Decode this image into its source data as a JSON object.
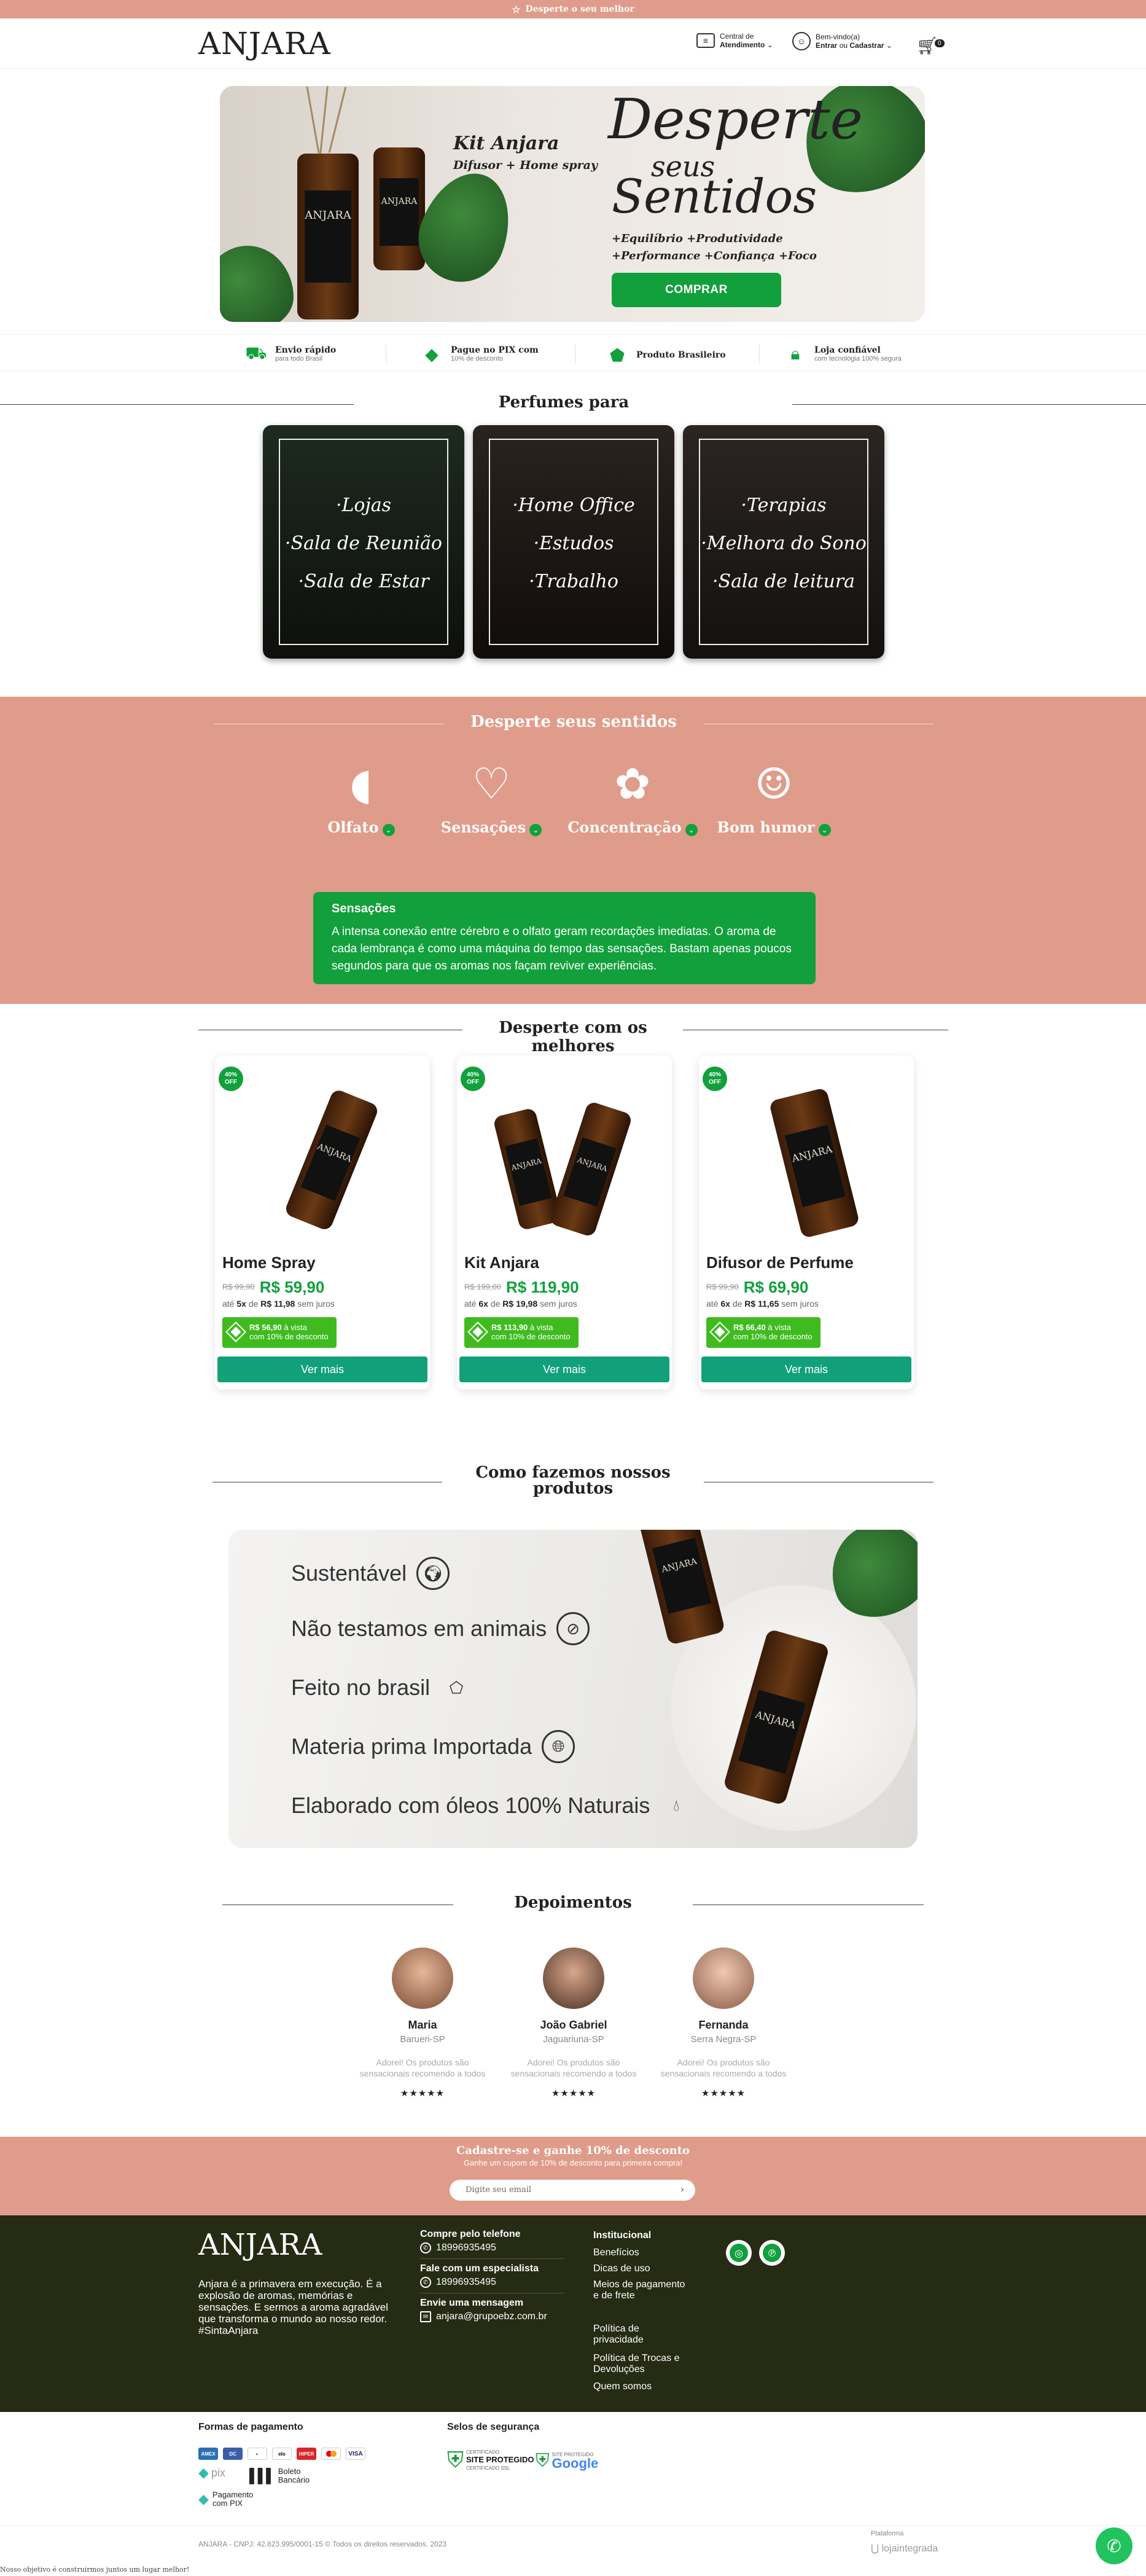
{
  "topbar": {
    "text": "Desperte o seu melhor"
  },
  "header": {
    "logo": "ANJARA",
    "central_line1": "Central de",
    "central_line2": "Atendimento",
    "welcome": "Bem-vindo(a)",
    "login": "Entrar",
    "or": "ou",
    "register": "Cadastrar",
    "cart_count": "0"
  },
  "hero": {
    "kit_title": "Kit Anjara",
    "kit_sub": "Difusor + Home spray",
    "script_1": "Desperte",
    "script_2": "seus",
    "script_3": "Sentidos",
    "benefits_1": "+Equilíbrio  +Produtividade",
    "benefits_2": "+Performance  +Confiança  +Foco",
    "bottle_label": "ANJARA",
    "cta": "COMPRAR"
  },
  "features": [
    {
      "title": "Envio rápido",
      "sub": "para todo Brasil",
      "icon": "truck-icon"
    },
    {
      "title": "Pague no PIX com",
      "sub": "10% de desconto",
      "icon": "pix-icon"
    },
    {
      "title": "Produto Brasileiro",
      "sub": "",
      "icon": "brazil-map-icon"
    },
    {
      "title": "Loja confiável",
      "sub": "com tecnologia 100% segura",
      "icon": "lock-icon"
    }
  ],
  "perfumes": {
    "title": "Perfumes para",
    "cards": [
      {
        "lines": [
          "·Lojas",
          "·Sala de Reunião",
          "·Sala de Estar"
        ]
      },
      {
        "lines": [
          "·Home Office",
          "·Estudos",
          "·Trabalho"
        ]
      },
      {
        "lines": [
          "·Terapias",
          "·Melhora do Sono",
          "·Sala de leitura"
        ]
      }
    ]
  },
  "senses": {
    "title": "Desperte seus sentidos",
    "items": [
      {
        "label": "Olfato",
        "icon": "nose-icon"
      },
      {
        "label": "Sensações",
        "icon": "heart-brain-icon"
      },
      {
        "label": "Concentração",
        "icon": "brain-icon"
      },
      {
        "label": "Bom humor",
        "icon": "smile-face-icon"
      }
    ],
    "box_title": "Sensações",
    "box_text": "A intensa conexão entre cérebro e o olfato geram recordações imediatas. O aroma de cada lembrança é como uma máquina do tempo das sensações. Bastam apenas poucos segundos para que os aromas nos façam reviver experiências."
  },
  "products": {
    "title": "Desperte com os melhores",
    "items": [
      {
        "badge_pct": "40%",
        "badge_off": "OFF",
        "name": "Home Spray",
        "old": "R$ 99,90",
        "price": "R$ 59,90",
        "inst_pre": "até",
        "inst_n": "5x",
        "inst_de": "de",
        "inst_val": "R$ 11,98",
        "inst_post": "sem juros",
        "pix_val": "R$ 56,90",
        "pix_tail": "à vista",
        "pix_line2": "com 10% de desconto",
        "button": "Ver mais"
      },
      {
        "badge_pct": "40%",
        "badge_off": "OFF",
        "name": "Kit Anjara",
        "old": "R$ 199,00",
        "price": "R$ 119,90",
        "inst_pre": "até",
        "inst_n": "6x",
        "inst_de": "de",
        "inst_val": "R$ 19,98",
        "inst_post": "sem juros",
        "pix_val": "R$ 113,90",
        "pix_tail": "à vista",
        "pix_line2": "com 10% de desconto",
        "button": "Ver mais"
      },
      {
        "badge_pct": "40%",
        "badge_off": "OFF",
        "name": "Difusor de Perfume",
        "old": "R$ 99,90",
        "price": "R$ 69,90",
        "inst_pre": "até",
        "inst_n": "6x",
        "inst_de": "de",
        "inst_val": "R$ 11,65",
        "inst_post": "sem juros",
        "pix_val": "R$ 66,40",
        "pix_tail": "à vista",
        "pix_line2": "com 10% de desconto",
        "button": "Ver mais"
      }
    ]
  },
  "como": {
    "title_1": "Como fazemos nossos",
    "title_2": "produtos",
    "items": [
      {
        "label": "Sustentável",
        "icon": "globe-leaf-icon"
      },
      {
        "label": "Não testamos em animais",
        "icon": "rabbit-icon"
      },
      {
        "label": "Feito no brasil",
        "icon": "brazil-map-icon"
      },
      {
        "label": "Materia prima Importada",
        "icon": "globe-icon"
      },
      {
        "label": "Elaborado com óleos 100% Naturais",
        "icon": "drop-icon"
      }
    ]
  },
  "testimonials": {
    "title": "Depoimentos",
    "items": [
      {
        "name": "Maria",
        "loc": "Barueri-SP",
        "text": "Adorei! Os produtos são sensacionais recomendo a todos",
        "stars": "★★★★★"
      },
      {
        "name": "João Gabriel",
        "loc": "Jaguariuna-SP",
        "text": "Adorei! Os produtos são sensacionais recomendo a todos",
        "stars": "★★★★★"
      },
      {
        "name": "Fernanda",
        "loc": "Serra Negra-SP",
        "text": "Adorei! Os produtos são sensacionais recomendo a todos",
        "stars": "★★★★★"
      }
    ]
  },
  "newsletter": {
    "title": "Cadastre-se e ganhe 10% de desconto",
    "sub": "Ganhe um cupom de 10% de desconto para primeira compra!",
    "placeholder": "Digite seu email"
  },
  "footer": {
    "logo": "ANJARA",
    "about": "Anjara é a primavera em execução. É a explosão de aromas, memórias e sensações. E sermos a aroma agradável que transforma o mundo ao nosso redor. #SintaAnjara",
    "buy_phone_title": "Compre pelo telefone",
    "buy_phone": "18996935495",
    "specialist_title": "Fale com um especialista",
    "specialist_phone": "18996935495",
    "message_title": "Envie uma mensagem",
    "email": "anjara@grupoebz.com.br",
    "inst_title": "Institucional",
    "links": [
      "Benefícios",
      "Dicas de uso",
      "Meios de pagamento e de frete",
      "Política de privacidade",
      "Política de Trocas e Devoluções",
      "Quem somos"
    ]
  },
  "payments": {
    "title": "Formas de pagamento",
    "boleto": "Boleto Bancário",
    "pix": "Pagamento com PIX",
    "seals_title": "Selos de segurança",
    "seal1_top": "CERTIFICADO",
    "seal1_main": "SITE PROTEGIDO",
    "seal1_bottom": "CERTIFICADO SSL",
    "seal2_top": "SITE PROTEGIDO",
    "seal2_main": "Google"
  },
  "bottom": {
    "copyright": "ANJARA - CNPJ: 42.823.995/0001-15 © Todos os direitos reservados. 2023",
    "platform_label": "Plataforma",
    "platform": "lojaintegrada",
    "objective": "Nosso objetivo é construirmos juntos um lugar melhor!"
  },
  "colors": {
    "accent_green": "#12a03c",
    "pink": "#e09c8a",
    "footer_bg": "#262b14"
  }
}
